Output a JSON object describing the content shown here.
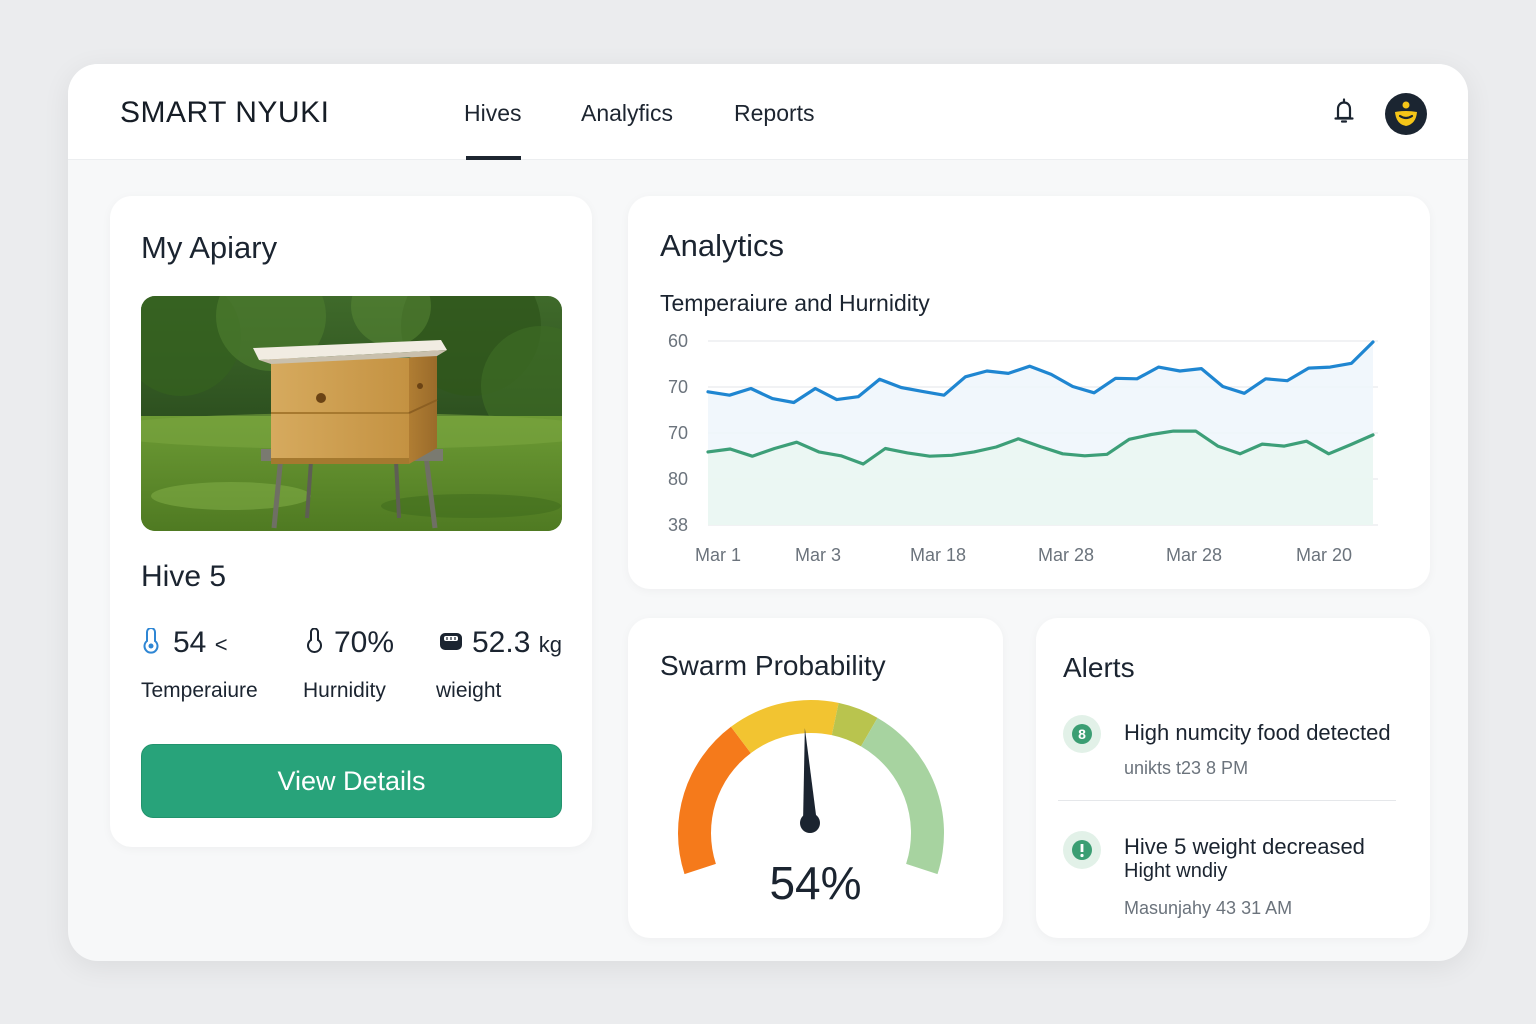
{
  "brand": "SMART NYUKI",
  "nav": {
    "tabs": [
      "Hives",
      "Analyfics",
      "Reports"
    ],
    "active": "Hives"
  },
  "header_icons": [
    "bell-icon",
    "avatar-bee-icon"
  ],
  "apiary": {
    "title": "My Apiary",
    "hive_name": "Hive 5",
    "stats": [
      {
        "icon": "thermometer-icon",
        "value": "54",
        "unit": "<",
        "label": "Temperaiure"
      },
      {
        "icon": "droplet-icon",
        "value": "70%",
        "unit": "",
        "label": "Hurnidity"
      },
      {
        "icon": "scale-icon",
        "value": "52.3",
        "unit": "kg",
        "label": "wieight"
      }
    ],
    "button": "View Details"
  },
  "analytics": {
    "title": "Analytics",
    "subtitle": "Temperaiure and Hurnidity"
  },
  "chart_data": {
    "type": "area",
    "title": "Temperaiure and Hurnidity",
    "y_tick_labels": [
      "60",
      "70",
      "70",
      "80",
      "38"
    ],
    "x_tick_labels": [
      "Mar 1",
      "Mar 3",
      "Mar 18",
      "Mar 28",
      "Mar 28",
      "Mar 20"
    ],
    "grid": true,
    "colors": {
      "series_1": "#1f86d1",
      "series_2": "#3d9f78"
    },
    "series": [
      {
        "values": [
          65.5,
          64.8,
          66.2,
          64.1,
          63.3,
          66.2,
          63.9,
          64.5,
          68.1,
          66.4,
          65.6,
          64.8,
          68.6,
          69.8,
          69.3,
          70.8,
          69.1,
          66.6,
          65.3,
          68.3,
          68.2,
          70.6,
          69.8,
          70.3,
          66.6,
          65.2,
          68.2,
          67.8,
          70.4,
          70.6,
          71.4,
          75.8
        ]
      },
      {
        "values": [
          53.1,
          53.7,
          52.2,
          53.8,
          55.1,
          53.1,
          52.3,
          50.6,
          53.8,
          52.9,
          52.2,
          52.4,
          53.1,
          54.1,
          55.8,
          54.2,
          52.7,
          52.3,
          52.6,
          55.7,
          56.7,
          57.4,
          57.4,
          54.3,
          52.7,
          54.7,
          54.3,
          55.3,
          52.7,
          54.6,
          56.6
        ]
      }
    ]
  },
  "swarm": {
    "title": "Swarm Probability",
    "value": 54,
    "value_text": "54%",
    "colors": [
      "#f57a1b",
      "#f2c431",
      "#b9c44e",
      "#a7d3a0"
    ]
  },
  "alerts": {
    "title": "Alerts",
    "items": [
      {
        "icon": "alert-badge-icon",
        "title": "High numcity food detected",
        "time": "unikts t23 8 PM"
      },
      {
        "icon": "info-badge-icon",
        "title": "Hive 5 weight decreased",
        "subtitle": "Hight wndiy",
        "time": "Masunjahy  43 31 AM"
      }
    ]
  }
}
